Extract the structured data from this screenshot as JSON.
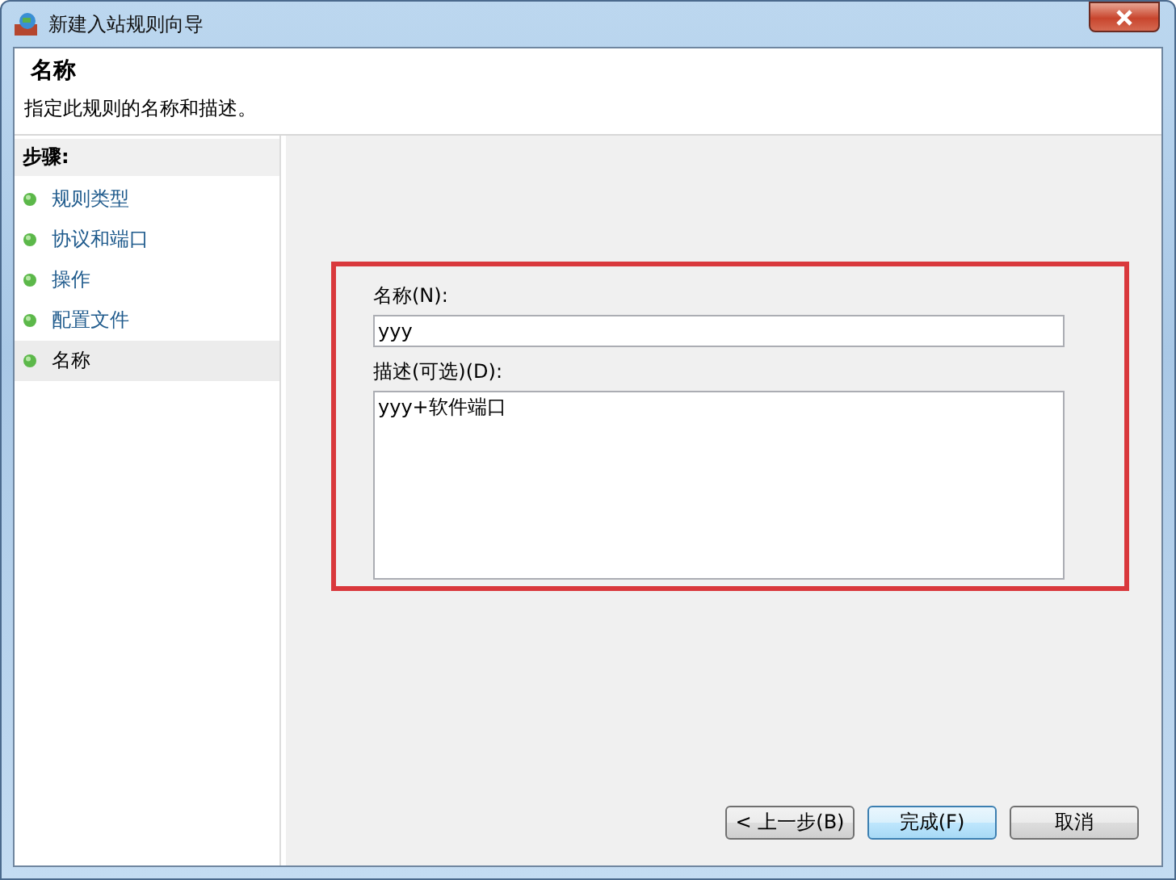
{
  "window": {
    "title": "新建入站规则向导"
  },
  "header": {
    "title": "名称",
    "subtitle": "指定此规则的名称和描述。"
  },
  "steps": {
    "title": "步骤:",
    "items": [
      {
        "label": "规则类型",
        "selected": false
      },
      {
        "label": "协议和端口",
        "selected": false
      },
      {
        "label": "操作",
        "selected": false
      },
      {
        "label": "配置文件",
        "selected": false
      },
      {
        "label": "名称",
        "selected": true
      }
    ]
  },
  "form": {
    "name_label": "名称(N):",
    "name_value": "yyy",
    "description_label": "描述(可选)(D):",
    "description_value": "yyy+软件端口"
  },
  "buttons": [
    "< 上一步(B)",
    "完成(F)",
    "取消"
  ]
}
